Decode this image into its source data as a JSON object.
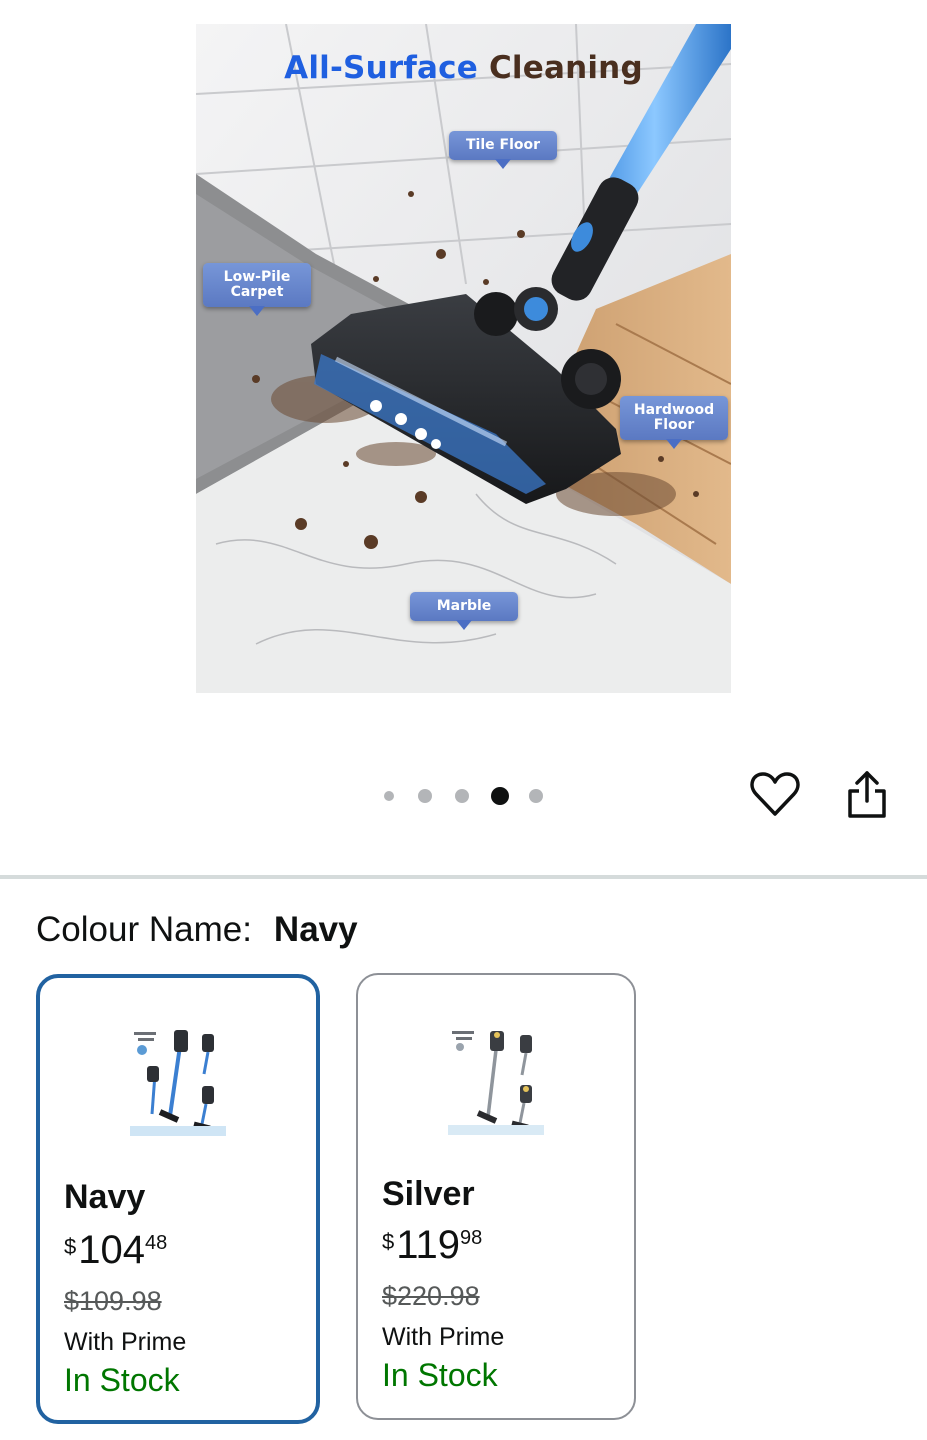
{
  "hero": {
    "title_part1": "All-Surface",
    "title_part2": "Cleaning",
    "tags": {
      "tile": "Tile Floor",
      "carpet": "Low-Pile Carpet",
      "hardwood": "Hardwood Floor",
      "marble": "Marble"
    }
  },
  "carousel": {
    "count": 5,
    "active_index": 3
  },
  "actions": {
    "wishlist_icon": "heart-icon",
    "share_icon": "share-icon"
  },
  "colour": {
    "label": "Colour Name:",
    "selected": "Navy",
    "options": [
      {
        "name": "Navy",
        "currency": "$",
        "price_whole": "104",
        "price_fraction": "48",
        "was": "$109.98",
        "prime": "With Prime",
        "stock": "In Stock",
        "selected": true
      },
      {
        "name": "Silver",
        "currency": "$",
        "price_whole": "119",
        "price_fraction": "98",
        "was": "$220.98",
        "prime": "With Prime",
        "stock": "In Stock",
        "selected": false
      }
    ]
  },
  "colors": {
    "accent_blue": "#2162a1",
    "in_stock_green": "#007600",
    "title_blue": "#1f5fe0",
    "title_brown": "#4a2f1f"
  }
}
